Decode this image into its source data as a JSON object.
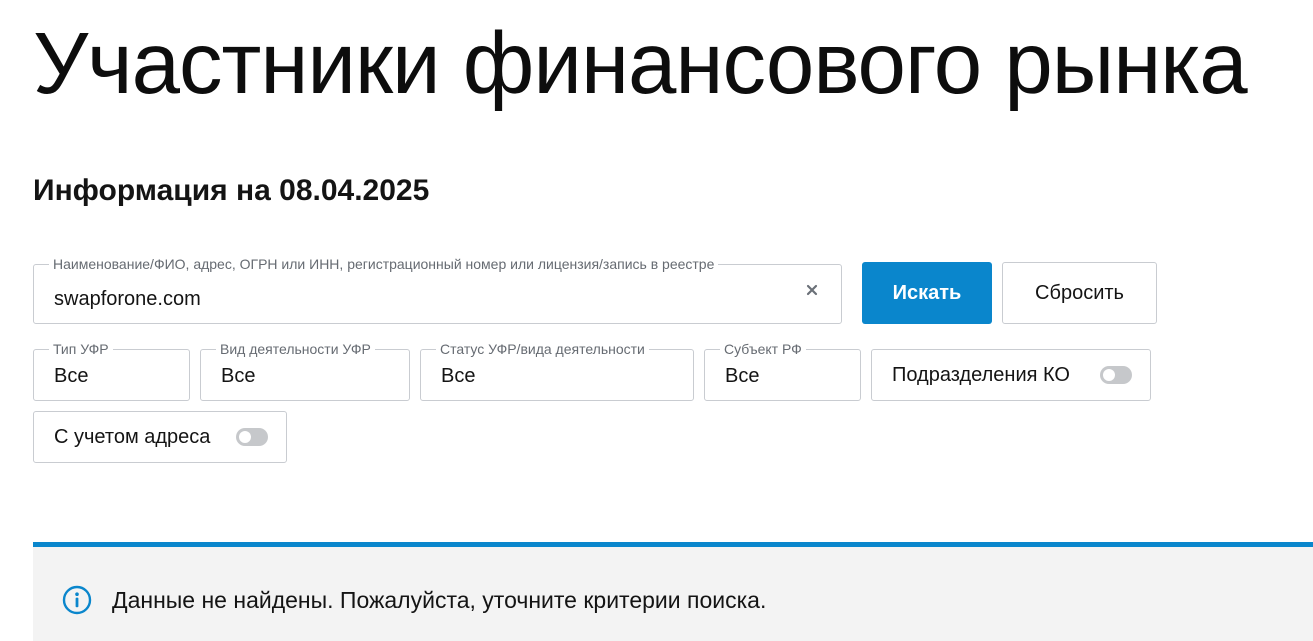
{
  "page": {
    "title": "Участники финансового рынка",
    "info_date": "Информация на 08.04.2025"
  },
  "search": {
    "legend": "Наименование/ФИО, адрес, ОГРН или ИНН, регистрационный номер или лицензия/запись в реестре",
    "value": "swapforone.com",
    "clear_icon": "close-icon",
    "search_label": "Искать",
    "reset_label": "Сбросить"
  },
  "filters": {
    "type": {
      "legend": "Тип УФР",
      "value": "Все"
    },
    "activity": {
      "legend": "Вид деятельности УФР",
      "value": "Все"
    },
    "status": {
      "legend": "Статус УФР/вида деятельности",
      "value": "Все"
    },
    "region": {
      "legend": "Субъект РФ",
      "value": "Все"
    },
    "divisions_toggle": {
      "label": "Подразделения КО",
      "enabled": false
    },
    "address_toggle": {
      "label": "С учетом адреса",
      "enabled": false
    }
  },
  "notice": {
    "icon": "info-icon",
    "text": "Данные не найдены. Пожалуйста, уточните критерии поиска."
  },
  "colors": {
    "accent": "#0a86cc",
    "notice_background": "#f3f3f3",
    "border": "#c9ccd1",
    "toggle_off": "#c6c8cb"
  }
}
